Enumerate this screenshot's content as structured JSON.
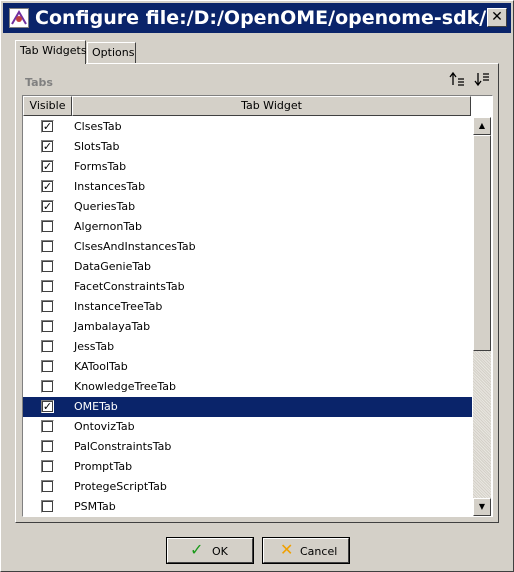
{
  "window": {
    "title": "Configure file:/D:/OpenOME/openome-sdk/..."
  },
  "tabs": [
    {
      "label": "Tab Widgets",
      "active": true
    },
    {
      "label": "Options",
      "active": false
    }
  ],
  "section": {
    "label": "Tabs"
  },
  "table": {
    "columns": [
      "Visible",
      "Tab Widget"
    ],
    "rows": [
      {
        "visible": true,
        "name": "ClsesTab"
      },
      {
        "visible": true,
        "name": "SlotsTab"
      },
      {
        "visible": true,
        "name": "FormsTab"
      },
      {
        "visible": true,
        "name": "InstancesTab"
      },
      {
        "visible": true,
        "name": "QueriesTab"
      },
      {
        "visible": false,
        "name": "AlgernonTab"
      },
      {
        "visible": false,
        "name": "ClsesAndInstancesTab"
      },
      {
        "visible": false,
        "name": "DataGenieTab"
      },
      {
        "visible": false,
        "name": "FacetConstraintsTab"
      },
      {
        "visible": false,
        "name": "InstanceTreeTab"
      },
      {
        "visible": false,
        "name": "JambalayaTab"
      },
      {
        "visible": false,
        "name": "JessTab"
      },
      {
        "visible": false,
        "name": "KAToolTab"
      },
      {
        "visible": false,
        "name": "KnowledgeTreeTab"
      },
      {
        "visible": true,
        "name": "OMETab",
        "selected": true
      },
      {
        "visible": false,
        "name": "OntovizTab"
      },
      {
        "visible": false,
        "name": "PalConstraintsTab"
      },
      {
        "visible": false,
        "name": "PromptTab"
      },
      {
        "visible": false,
        "name": "ProtegeScriptTab"
      },
      {
        "visible": false,
        "name": "PSMTab"
      }
    ]
  },
  "buttons": {
    "ok": "OK",
    "cancel": "Cancel"
  },
  "icons": {
    "app": "protege-icon",
    "close": "close-icon",
    "sort_up": "move-up-icon",
    "sort_down": "move-down-icon",
    "ok": "checkmark-icon",
    "cancel": "x-icon"
  },
  "colors": {
    "titlebar": "#0a246a",
    "selection": "#0a246a",
    "ok_glyph": "#1a9a1a",
    "cancel_glyph": "#f0a000"
  }
}
